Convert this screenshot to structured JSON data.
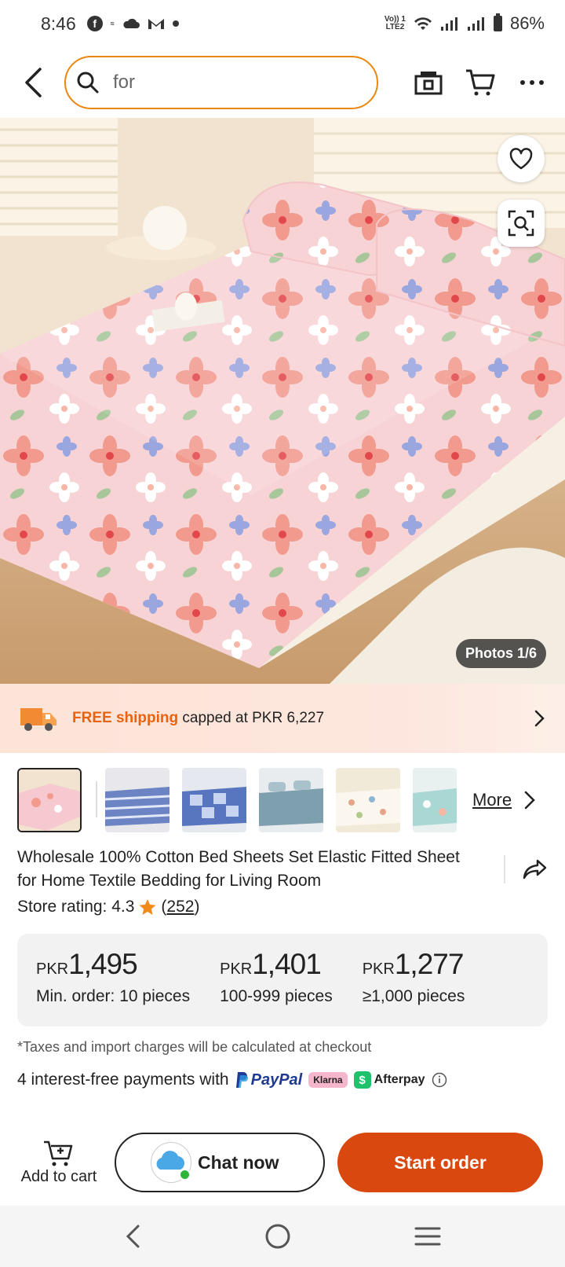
{
  "status_bar": {
    "time": "8:46",
    "volte_line1": "Vo)) 1",
    "volte_line2": "LTE2",
    "battery": "86%"
  },
  "header": {
    "search_value": "for",
    "icons": [
      "back-icon",
      "search-icon",
      "camera-icon",
      "cart-icon",
      "more-icon"
    ]
  },
  "gallery": {
    "photos_badge": "Photos 1/6"
  },
  "shipping": {
    "free_label": "FREE shipping",
    "rest": " capped at PKR 6,227"
  },
  "thumbnails": {
    "more_label": "More"
  },
  "product": {
    "title": "Wholesale 100% Cotton Bed Sheets Set Elastic Fitted Sheet for Home Textile Bedding for Living Room",
    "rating_label": "Store rating: 4.3",
    "rating_count": "252"
  },
  "prices": [
    {
      "currency": "PKR",
      "amount": "1,495",
      "qty": "Min. order: 10 pieces"
    },
    {
      "currency": "PKR",
      "amount": "1,401",
      "qty": "100-999 pieces"
    },
    {
      "currency": "PKR",
      "amount": "1,277",
      "qty": "≥1,000 pieces"
    }
  ],
  "tax_note": "*Taxes and import charges will be calculated at checkout",
  "payments": {
    "label": "4 interest-free payments with",
    "paypal": "PayPal",
    "klarna": "Klarna",
    "afterpay": "Afterpay"
  },
  "actions": {
    "add_to_cart": "Add to cart",
    "chat_now": "Chat now",
    "start_order": "Start order"
  },
  "colors": {
    "accent_orange": "#d9480f",
    "search_border": "#e9870f",
    "free_shipping": "#e8620f"
  }
}
